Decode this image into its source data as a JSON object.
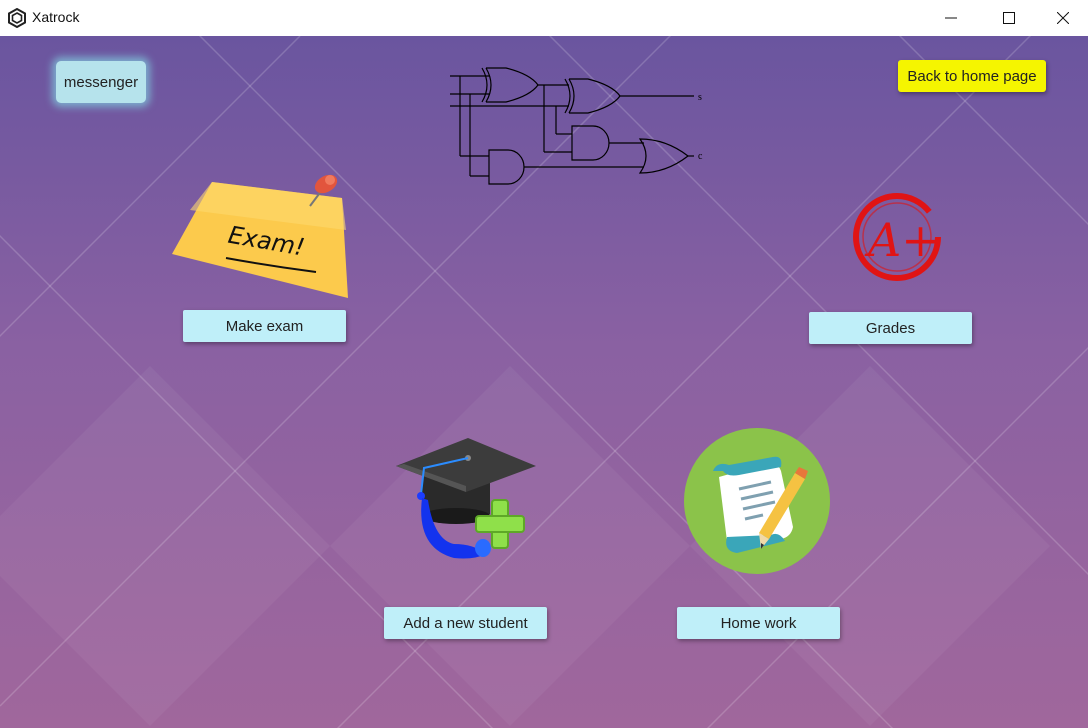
{
  "window": {
    "title": "Xatrock",
    "minimize": "—",
    "maximize": "☐",
    "close": "✕"
  },
  "buttons": {
    "messenger": "messenger",
    "back": "Back to home page",
    "make_exam": "Make exam",
    "grades": "Grades",
    "add_student": "Add a new student",
    "homework": "Home work"
  },
  "images": {
    "exam_note_text": "Exam!",
    "circuit_s": "s",
    "circuit_c": "c",
    "grade_text": "A+"
  },
  "colors": {
    "accent_yellow": "#f5f500",
    "button_bg": "#bfeff9",
    "bg_top": "#6a559f",
    "bg_bottom": "#a0679c"
  }
}
